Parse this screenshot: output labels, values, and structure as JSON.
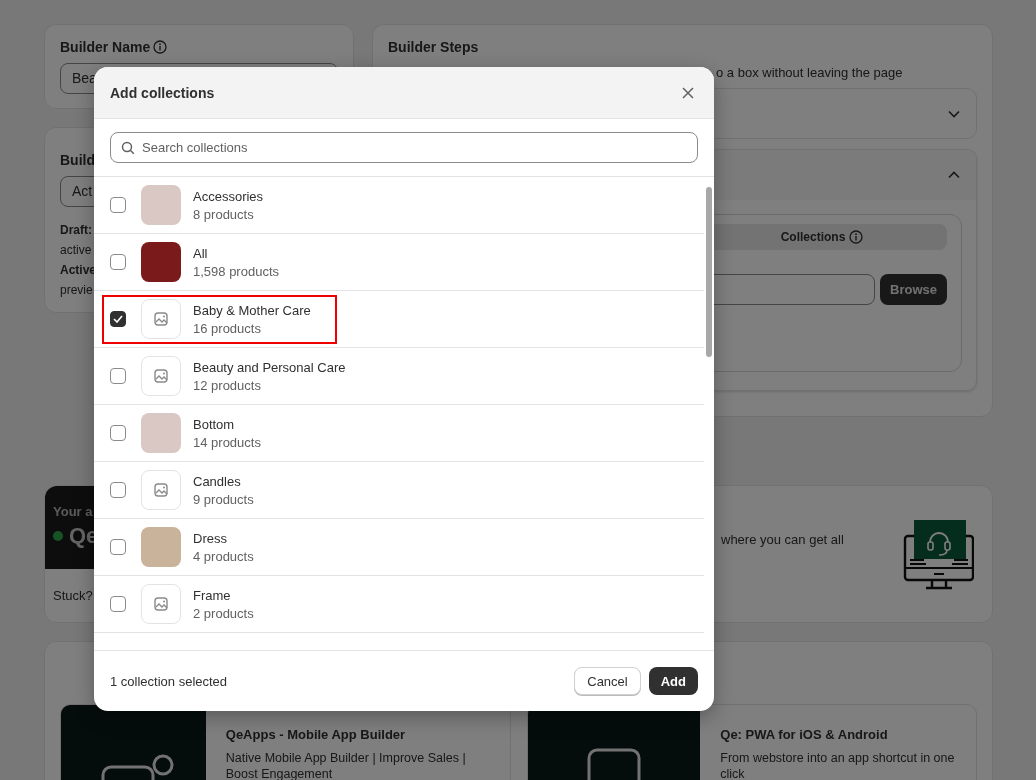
{
  "background": {
    "builder_name": {
      "title": "Builder Name",
      "value": "Bea"
    },
    "builder_status": {
      "title": "Build",
      "value": "Act",
      "lines": [
        {
          "text": "Draft:",
          "kind": "label"
        },
        {
          "text": "active",
          "kind": "text"
        },
        {
          "text": "Active",
          "kind": "label"
        },
        {
          "text": "previe",
          "kind": "text"
        }
      ]
    },
    "builder_steps": {
      "title": "Builder Steps",
      "subtitle": "o a box without leaving the page",
      "tab": "Collections",
      "browse": "Browse"
    },
    "support": {
      "heading": "Your a",
      "brand": "Qe",
      "stuck": "Stuck?",
      "text": "where you can get all"
    },
    "apps": [
      {
        "title": "QeApps - Mobile App Builder",
        "description": "Native Mobile App Builder | Improve Sales | Boost Engagement"
      },
      {
        "title": "Qe: PWA for iOS & Android",
        "description": "From webstore into an app shortcut in one click"
      }
    ]
  },
  "modal": {
    "title": "Add collections",
    "search": {
      "placeholder": "Search collections"
    },
    "items": [
      {
        "name": "Accessories",
        "count": "8 products",
        "has_image": true,
        "checked": false,
        "highlight": false
      },
      {
        "name": "All",
        "count": "1,598 products",
        "has_image": true,
        "checked": false,
        "highlight": false
      },
      {
        "name": "Baby & Mother Care",
        "count": "16 products",
        "has_image": false,
        "checked": true,
        "highlight": true
      },
      {
        "name": "Beauty and Personal Care",
        "count": "12 products",
        "has_image": false,
        "checked": false,
        "highlight": false
      },
      {
        "name": "Bottom",
        "count": "14 products",
        "has_image": true,
        "checked": false,
        "highlight": false
      },
      {
        "name": "Candles",
        "count": "9 products",
        "has_image": false,
        "checked": false,
        "highlight": false
      },
      {
        "name": "Dress",
        "count": "4 products",
        "has_image": true,
        "checked": false,
        "highlight": false
      },
      {
        "name": "Frame",
        "count": "2 products",
        "has_image": false,
        "checked": false,
        "highlight": false
      }
    ],
    "footer": {
      "status": "1 collection selected",
      "cancel": "Cancel",
      "add": "Add"
    }
  }
}
